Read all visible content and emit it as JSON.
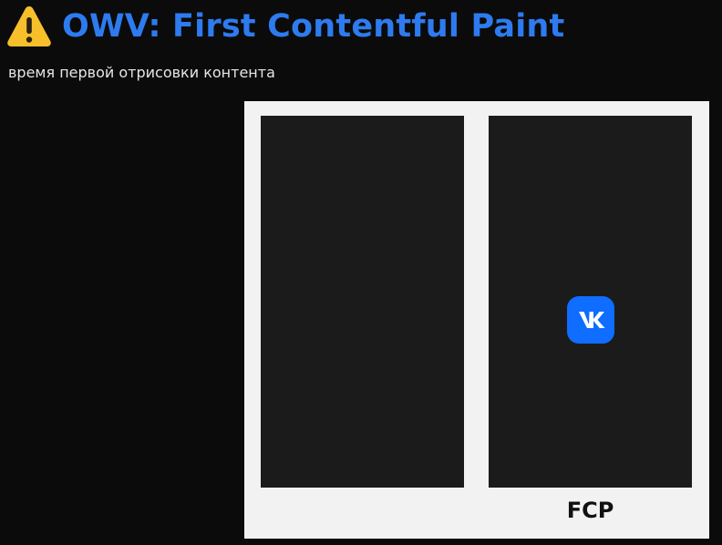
{
  "header": {
    "title": "OWV: First Contentful Paint",
    "subtitle": "время первой отрисовки контента",
    "icon": "warning-icon"
  },
  "filmstrip": {
    "frames": [
      {
        "content": "empty"
      },
      {
        "content": "vk-logo",
        "label": "FCP"
      }
    ]
  },
  "colors": {
    "background": "#0b0b0b",
    "title": "#2e7bf0",
    "frame_border": "#f2f2f2",
    "panel": "#1b1b1b",
    "vk_brand": "#0f6dff",
    "warning": "#f7c02a"
  }
}
